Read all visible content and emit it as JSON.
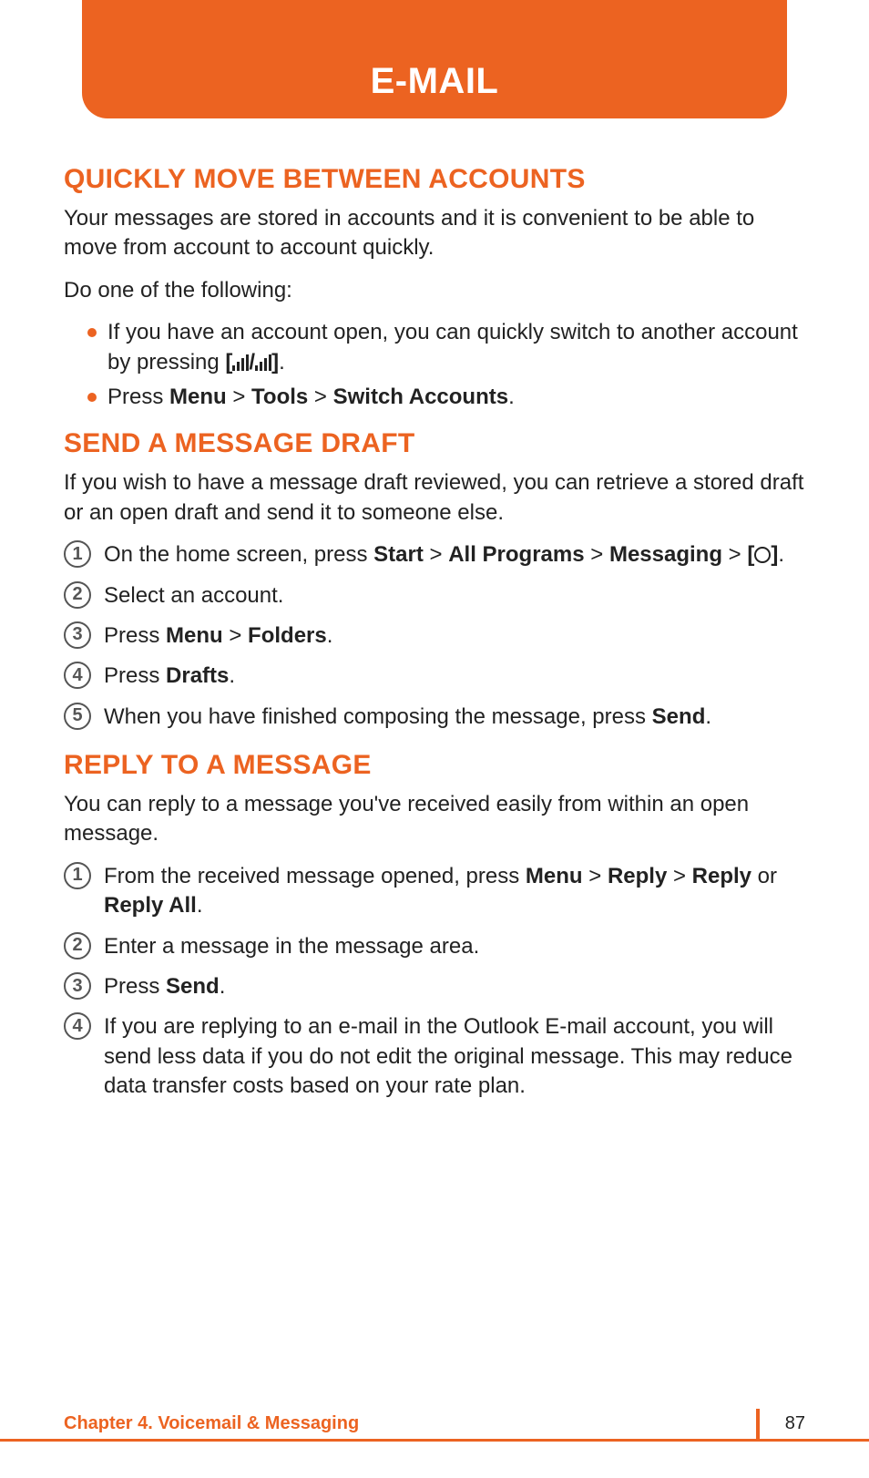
{
  "header": {
    "title": "E-MAIL"
  },
  "sections": {
    "quick": {
      "heading": "QUICKLY MOVE BETWEEN ACCOUNTS",
      "intro": "Your messages are stored in accounts and it is convenient to be able to move from account to account quickly.",
      "do_one": "Do one of the following:",
      "bullet1_a": "If you have an account open, you can quickly switch to another account by pressing ",
      "bullet1_b": "[",
      "bullet1_c": "/",
      "bullet1_d": "]",
      "bullet1_e": ".",
      "bullet2_a": "Press ",
      "bullet2_b": "Menu",
      "bullet2_c": " > ",
      "bullet2_d": "Tools",
      "bullet2_e": " > ",
      "bullet2_f": "Switch Accounts",
      "bullet2_g": "."
    },
    "draft": {
      "heading": "SEND A MESSAGE DRAFT",
      "intro": "If you wish to have a message draft reviewed, you can retrieve a stored draft or an open draft and send it to someone else.",
      "s1_a": "On the home screen, press ",
      "s1_b": "Start",
      "s1_c": " > ",
      "s1_d": "All Programs",
      "s1_e": " > ",
      "s1_f": "Messaging",
      "s1_g": " > ",
      "s1_h": "[",
      "s1_i": "]",
      "s1_j": ".",
      "s2": "Select an account.",
      "s3_a": "Press ",
      "s3_b": "Menu",
      "s3_c": " > ",
      "s3_d": "Folders",
      "s3_e": ".",
      "s4_a": "Press ",
      "s4_b": "Drafts",
      "s4_c": ".",
      "s5_a": "When you have finished composing the message, press ",
      "s5_b": "Send",
      "s5_c": "."
    },
    "reply": {
      "heading": "REPLY TO A MESSAGE",
      "intro": "You can reply to a message you've received easily from within an open message.",
      "s1_a": "From the received message opened, press ",
      "s1_b": "Menu",
      "s1_c": " > ",
      "s1_d": "Reply",
      "s1_e": " > ",
      "s1_f": "Reply",
      "s1_g": " or ",
      "s1_h": "Reply All",
      "s1_i": ".",
      "s2": "Enter a message in the message area.",
      "s3_a": "Press ",
      "s3_b": "Send",
      "s3_c": ".",
      "s4": "If you are replying to an e-mail in the Outlook E-mail account, you will send less data if you do not edit the original message. This may reduce data transfer costs based on your rate plan."
    }
  },
  "footer": {
    "chapter": "Chapter 4. Voicemail & Messaging",
    "page": "87"
  },
  "nums": {
    "n1": "1",
    "n2": "2",
    "n3": "3",
    "n4": "4",
    "n5": "5"
  }
}
